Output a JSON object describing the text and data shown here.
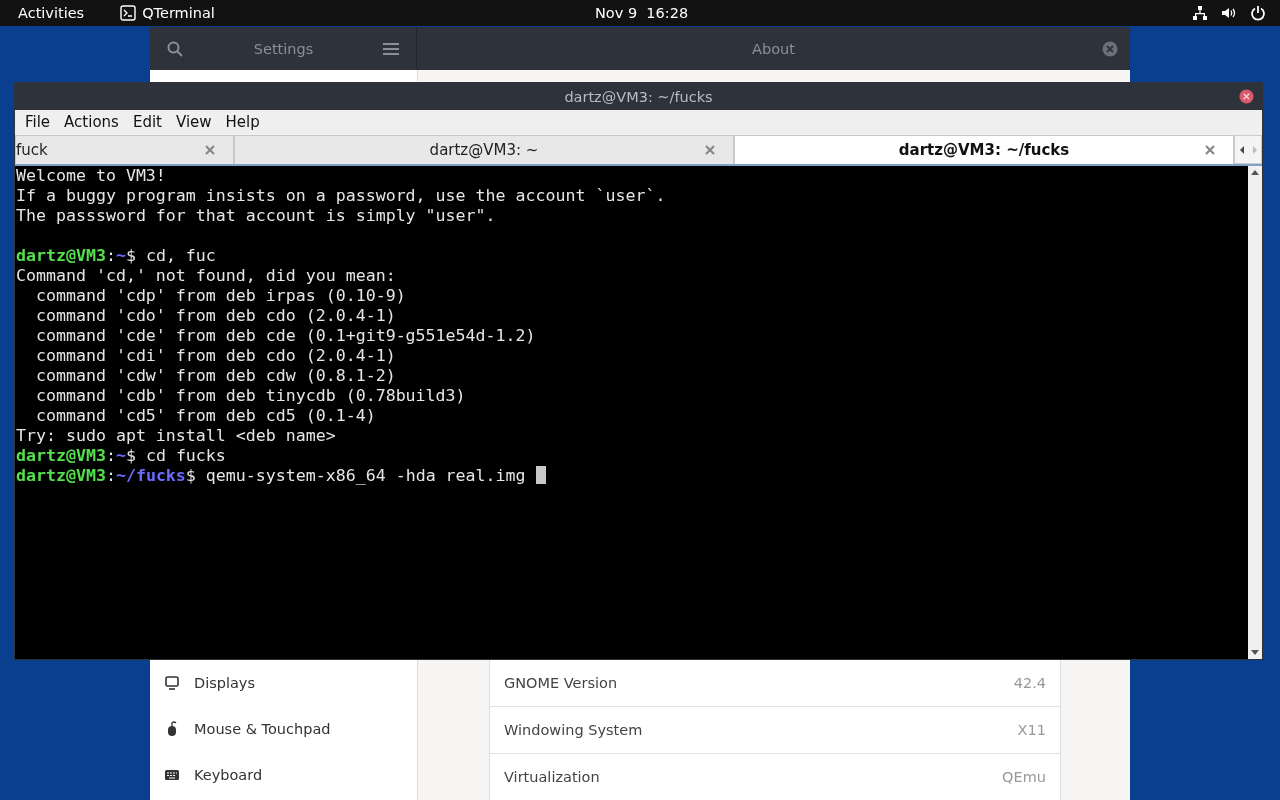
{
  "top_bar": {
    "activities": "Activities",
    "app": "QTerminal",
    "clock": "Nov 9  16:28"
  },
  "settings_window": {
    "title": "Settings",
    "page_title": "About",
    "sidebar": {
      "items": [
        {
          "label": "Displays",
          "selected": false
        },
        {
          "label": "Mouse & Touchpad",
          "selected": false
        },
        {
          "label": "Keyboard",
          "selected": false
        }
      ]
    },
    "about_rows": [
      {
        "label": "GNOME Version",
        "value": "42.4"
      },
      {
        "label": "Windowing System",
        "value": "X11"
      },
      {
        "label": "Virtualization",
        "value": "QEmu"
      }
    ]
  },
  "terminal_window": {
    "title": "dartz@VM3: ~/fucks",
    "menu": [
      "File",
      "Actions",
      "Edit",
      "View",
      "Help"
    ],
    "tabs": [
      {
        "label": "fuck",
        "selected": false
      },
      {
        "label": "dartz@VM3: ~",
        "selected": false
      },
      {
        "label": "dartz@VM3: ~/fucks",
        "selected": true
      }
    ],
    "lines": [
      {
        "kind": "output",
        "text": "Welcome to VM3!"
      },
      {
        "kind": "output",
        "text": "If a buggy program insists on a password, use the account `user`."
      },
      {
        "kind": "output",
        "text": "The passsword for that account is simply \"user\"."
      },
      {
        "kind": "blank"
      },
      {
        "kind": "prompt",
        "user_host": "dartz@VM3",
        "separator": ":",
        "path": "~",
        "symbol": "$",
        "command": "cd, fuc",
        "cursor": false
      },
      {
        "kind": "output",
        "text": "Command 'cd,' not found, did you mean:"
      },
      {
        "kind": "output",
        "text": "  command 'cdp' from deb irpas (0.10-9)"
      },
      {
        "kind": "output",
        "text": "  command 'cdo' from deb cdo (2.0.4-1)"
      },
      {
        "kind": "output",
        "text": "  command 'cde' from deb cde (0.1+git9-g551e54d-1.2)"
      },
      {
        "kind": "output",
        "text": "  command 'cdi' from deb cdo (2.0.4-1)"
      },
      {
        "kind": "output",
        "text": "  command 'cdw' from deb cdw (0.8.1-2)"
      },
      {
        "kind": "output",
        "text": "  command 'cdb' from deb tinycdb (0.78build3)"
      },
      {
        "kind": "output",
        "text": "  command 'cd5' from deb cd5 (0.1-4)"
      },
      {
        "kind": "output",
        "text": "Try: sudo apt install <deb name>"
      },
      {
        "kind": "prompt",
        "user_host": "dartz@VM3",
        "separator": ":",
        "path": "~",
        "symbol": "$",
        "command": "cd fucks",
        "cursor": false
      },
      {
        "kind": "prompt",
        "user_host": "dartz@VM3",
        "separator": ":",
        "path": "~/fucks",
        "symbol": "$",
        "command": "qemu-system-x86_64 -hda real.img",
        "cursor": true
      }
    ]
  }
}
